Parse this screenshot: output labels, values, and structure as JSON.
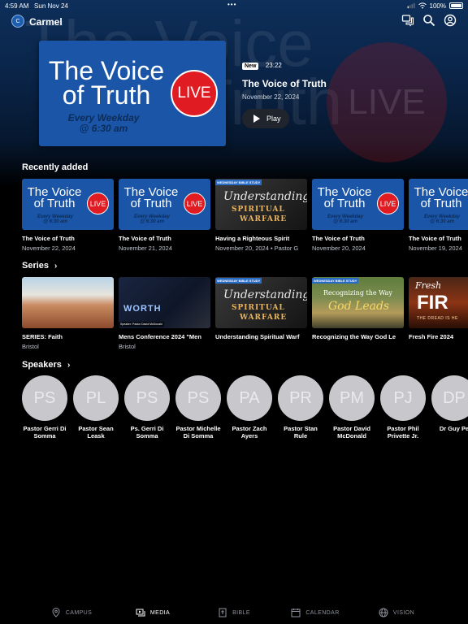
{
  "status_bar": {
    "time": "4:59 AM",
    "date": "Sun Nov 24",
    "dots": "•••",
    "battery": "100%"
  },
  "app": {
    "name": "Carmel",
    "logo_text": "C"
  },
  "hero": {
    "bg_title_line1": "The Voice",
    "bg_title_line2": "of Truth",
    "bg_live": "LIVE",
    "badge": "New",
    "duration": "23:22",
    "title": "The Voice of Truth",
    "date": "November 22, 2024",
    "play_label": "Play",
    "art": {
      "title_line1": "The Voice",
      "title_line2": "of Truth",
      "sub_line1": "Every Weekday",
      "sub_line2": "@ 6:30 am",
      "live": "LIVE"
    }
  },
  "recently_added": {
    "title": "Recently added",
    "items": [
      {
        "kind": "voice",
        "title": "The Voice of Truth",
        "subtitle": "November 22, 2024"
      },
      {
        "kind": "voice",
        "title": "The Voice of Truth",
        "subtitle": "November 21, 2024"
      },
      {
        "kind": "study",
        "title": "Having a Righteous Spirit",
        "subtitle": "November 20, 2024 • Pastor G"
      },
      {
        "kind": "voice",
        "title": "The Voice of Truth",
        "subtitle": "November 20, 2024"
      },
      {
        "kind": "voice",
        "title": "The Voice of Truth",
        "subtitle": "November 19, 2024"
      }
    ]
  },
  "voice_art": {
    "line1": "The Voice",
    "line2": "of Truth",
    "sub1": "Every Weekday",
    "sub2": "@ 6:30 am",
    "live": "LIVE"
  },
  "study_art": {
    "tag": "WEDNESDAY BIBLE STUDY",
    "line1": "Understanding",
    "line2": "SPIRITUAL",
    "line3": "WARFARE"
  },
  "series": {
    "title": "Series",
    "items": [
      {
        "kind": "faith",
        "title": "SERIES: Faith",
        "subtitle": "Bristol"
      },
      {
        "kind": "worth",
        "title": "Mens Conference 2024 \"Men",
        "subtitle": "Bristol",
        "art_word": "WORTH",
        "art_speaker": "Speaker: Pastor David McDonald"
      },
      {
        "kind": "study",
        "title": "Understanding Spiritual Warf",
        "subtitle": ""
      },
      {
        "kind": "godleads",
        "title": "Recognizing the Way God Le",
        "subtitle": "",
        "art_tag": "WEDNESDAY BIBLE STUDY",
        "art_line1": "Recognizing the Way",
        "art_line2": "God Leads"
      },
      {
        "kind": "fire",
        "title": "Fresh Fire 2024",
        "subtitle": "",
        "art_line1": "Fresh",
        "art_line2": "FIR",
        "art_line3": "THE DREAD IS HE"
      }
    ]
  },
  "speakers": {
    "title": "Speakers",
    "items": [
      {
        "initials": "PS",
        "name": "Pastor Gerri Di Somma"
      },
      {
        "initials": "PL",
        "name": "Pastor Sean Leask"
      },
      {
        "initials": "PS",
        "name": "Ps. Gerri Di Somma"
      },
      {
        "initials": "PS",
        "name": "Pastor Michelle Di Somma"
      },
      {
        "initials": "PA",
        "name": "Pastor Zach Ayers"
      },
      {
        "initials": "PR",
        "name": "Pastor Stan Rule"
      },
      {
        "initials": "PM",
        "name": "Pastor David McDonald"
      },
      {
        "initials": "PJ",
        "name": "Pastor Phil Privette Jr."
      },
      {
        "initials": "DP",
        "name": "Dr Guy Pe"
      }
    ]
  },
  "tabbar": {
    "campus": "CAMPUS",
    "media": "MEDIA",
    "bible": "BIBLE",
    "calendar": "CALENDAR",
    "vision": "VISION"
  },
  "colors": {
    "brand_blue": "#1a55a8",
    "live_red": "#e11b22",
    "avatar_gray": "#c7c7cc"
  }
}
